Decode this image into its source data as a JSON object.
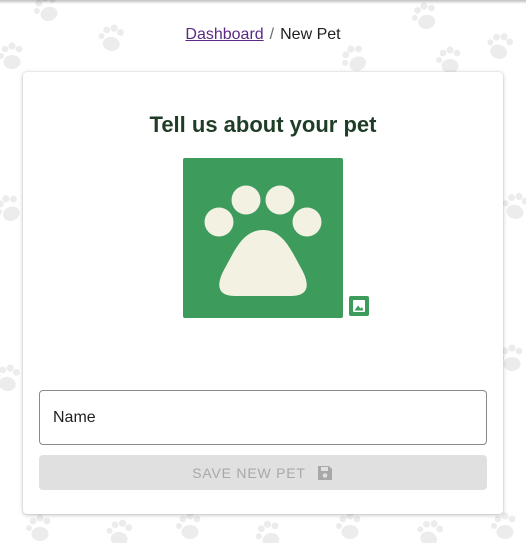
{
  "breadcrumb": {
    "items": [
      {
        "label": "Dashboard",
        "link": true
      },
      {
        "label": "New Pet",
        "link": false
      }
    ],
    "separator": "/"
  },
  "form": {
    "title": "Tell us about your pet",
    "avatar_icon": "paw-icon",
    "upload_icon": "image-icon",
    "name_placeholder": "Name",
    "save_label": "SAVE NEW PET",
    "save_icon": "floppy-disk-icon",
    "save_disabled": true
  },
  "colors": {
    "accent_green": "#3d9b5c",
    "paw_cream": "#f3f1e2",
    "title_dark_green": "#1f3d26",
    "link_purple": "#5b2a86",
    "pattern_gray": "#ececec"
  }
}
